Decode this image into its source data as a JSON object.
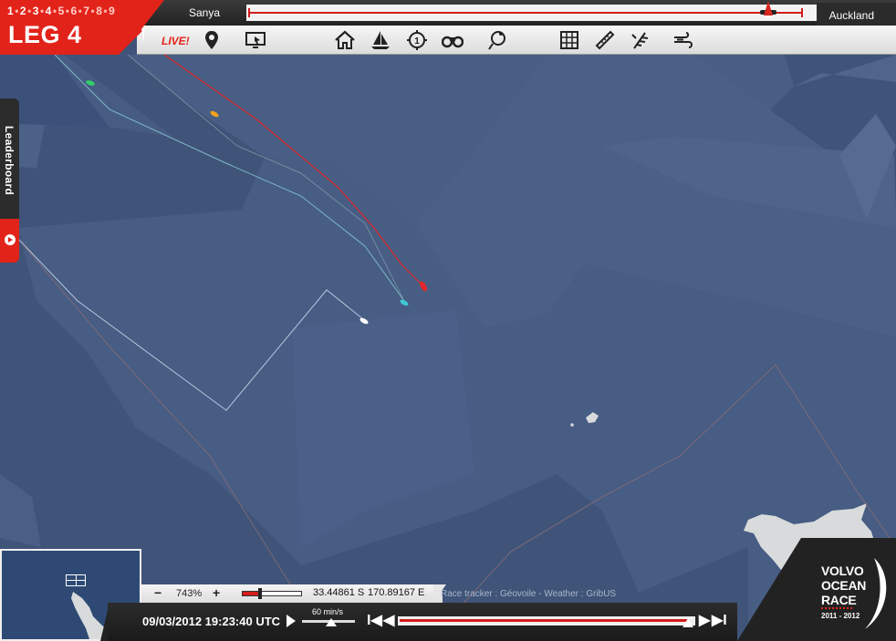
{
  "header": {
    "legs": [
      "1",
      "2",
      "3",
      "4",
      "5",
      "6",
      "7",
      "8",
      "9"
    ],
    "current_leg_index": 3,
    "leg_title": "LEG 4",
    "from_port": "Sanya",
    "to_port": "Auckland",
    "leg_progress": 0.94
  },
  "toolbar": {
    "live_label": "LIVE!",
    "tools": [
      {
        "icon": "map-pin-icon"
      },
      {
        "icon": "screen-cursor-icon"
      },
      {
        "icon": "home-icon"
      },
      {
        "icon": "sailboat-icon"
      },
      {
        "icon": "target-1-icon"
      },
      {
        "icon": "binoculars-icon"
      },
      {
        "icon": "route-icon"
      },
      {
        "icon": "grid-icon"
      },
      {
        "icon": "ruler-icon"
      },
      {
        "icon": "wind-barb-icon"
      },
      {
        "icon": "wind-gust-icon"
      }
    ]
  },
  "leaderboard": {
    "label": "Leaderboard"
  },
  "status": {
    "zoom_out": "−",
    "zoom_level": "743%",
    "zoom_in": "+",
    "zoom_position": 0.3,
    "latitude": "33.44861 S",
    "longitude": "170.89167 E",
    "credits": "Race tracker : Géovoile - Weather : GribUS"
  },
  "timebar": {
    "datetime": "09/03/2012 19:23:40 UTC",
    "speed": "60 min/s",
    "speed_position": 0.55,
    "timeline_position": 0.98,
    "skip_start": "I◀",
    "step_back": "◀",
    "step_forward": "▶",
    "skip_end": "▶I"
  },
  "logo": {
    "line1": "VOLVO",
    "line2": "OCEAN",
    "line3": "RACE",
    "years": "2011 - 2012"
  },
  "colors": {
    "accent": "#e2231a",
    "sea": "#3f5478",
    "sea_light": "#4a5f84",
    "sea_dark": "#34496d",
    "land": "#d8dadc"
  },
  "boats": [
    {
      "name": "green",
      "color": "#33d06a"
    },
    {
      "name": "orange",
      "color": "#f2a21b"
    },
    {
      "name": "red",
      "color": "#e0282a"
    },
    {
      "name": "cyan",
      "color": "#3ec8d6"
    },
    {
      "name": "white",
      "color": "#ffffff"
    }
  ]
}
